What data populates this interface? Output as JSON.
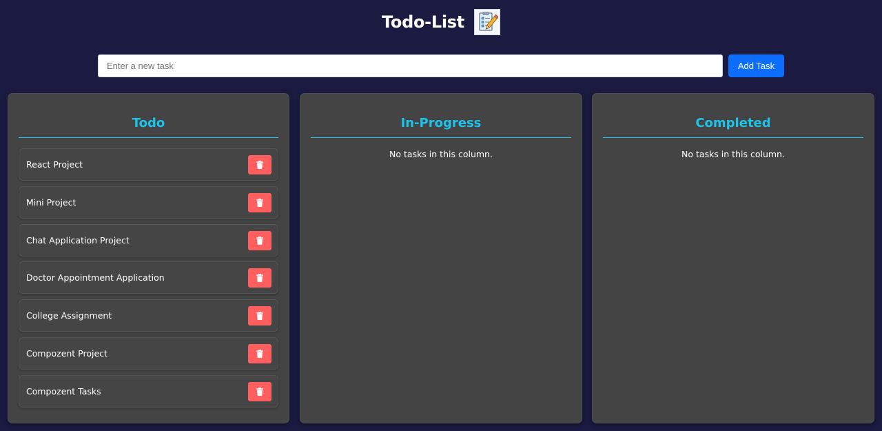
{
  "header": {
    "title": "Todo-List",
    "logo_icon": "checklist-pencil-icon"
  },
  "add_task": {
    "placeholder": "Enter a new task",
    "value": "",
    "button_label": "Add Task"
  },
  "colors": {
    "background": "#1b1a40",
    "column": "#444444",
    "accent": "#1ec3ea",
    "primary_button": "#0d6efd",
    "delete_button": "#ff5f5f"
  },
  "columns": [
    {
      "title": "Todo",
      "tasks": [
        {
          "label": "React Project",
          "icon": "trash-icon"
        },
        {
          "label": "Mini Project",
          "icon": "trash-icon"
        },
        {
          "label": "Chat Application Project",
          "icon": "trash-icon"
        },
        {
          "label": "Doctor Appointment Application",
          "icon": "trash-icon"
        },
        {
          "label": "College Assignment",
          "icon": "trash-icon"
        },
        {
          "label": "Compozent Project",
          "icon": "trash-icon"
        },
        {
          "label": "Compozent Tasks",
          "icon": "trash-icon"
        }
      ]
    },
    {
      "title": "In-Progress",
      "empty_message": "No tasks in this column."
    },
    {
      "title": "Completed",
      "empty_message": "No tasks in this column."
    }
  ]
}
